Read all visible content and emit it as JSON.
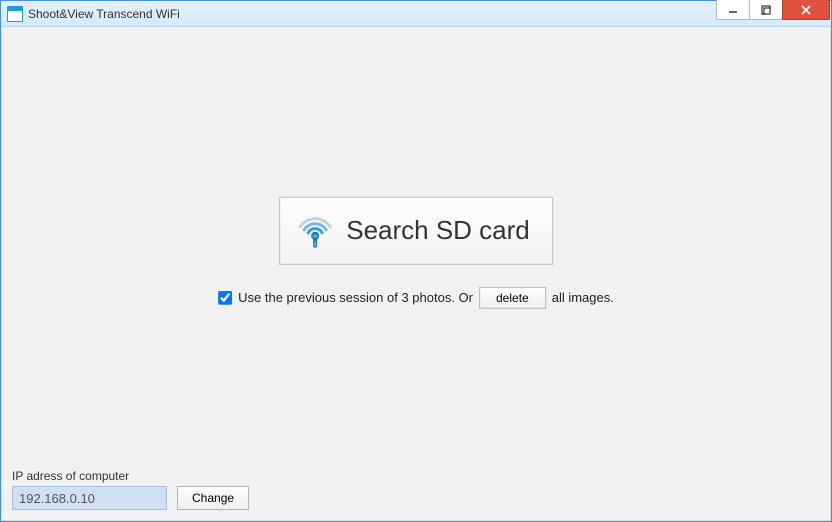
{
  "window": {
    "title": "Shoot&View Transcend WiFi"
  },
  "main": {
    "search_button_label": "Search SD card",
    "session_checkbox_label_prefix": "Use the previous session of 3 photos. Or",
    "session_checkbox_label_suffix": "all images.",
    "delete_button_label": "delete",
    "session_checked": true
  },
  "footer": {
    "ip_label": "IP adress of computer",
    "ip_value": "192.168.0.10",
    "change_button_label": "Change"
  }
}
